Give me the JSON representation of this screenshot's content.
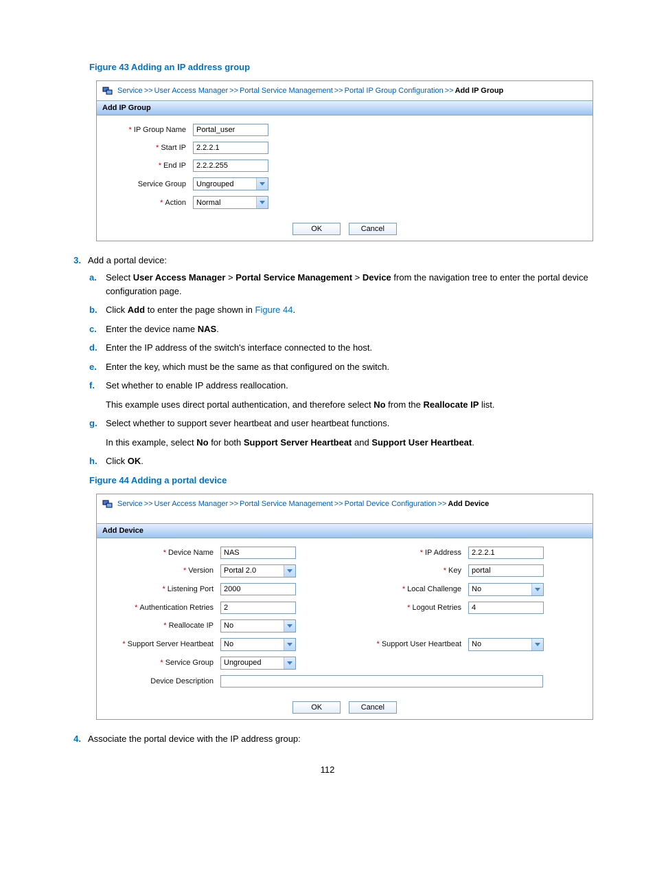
{
  "figure43": {
    "title": "Figure 43 Adding an IP address group",
    "breadcrumb": {
      "parts": [
        "Service",
        "User Access Manager",
        "Portal Service Management",
        "Portal IP Group Configuration"
      ],
      "current": "Add IP Group"
    },
    "panel_title": "Add IP Group",
    "rows": {
      "ip_group_name": {
        "label": "IP Group Name",
        "value": "Portal_user"
      },
      "start_ip": {
        "label": "Start IP",
        "value": "2.2.2.1"
      },
      "end_ip": {
        "label": "End IP",
        "value": "2.2.2.255"
      },
      "service_group": {
        "label": "Service Group",
        "value": "Ungrouped"
      },
      "action": {
        "label": "Action",
        "value": "Normal"
      }
    },
    "buttons": {
      "ok": "OK",
      "cancel": "Cancel"
    }
  },
  "step3": {
    "num": "3.",
    "text": "Add a portal device:",
    "subs": {
      "a": {
        "letter": "a.",
        "pre": "Select ",
        "b1": "User Access Manager",
        "gt1": " > ",
        "b2": "Portal Service Management",
        "gt2": " > ",
        "b3": "Device",
        "post": " from the navigation tree to enter the portal device configuration page."
      },
      "b": {
        "letter": "b.",
        "pre": "Click ",
        "b1": "Add",
        "mid": " to enter the page shown in ",
        "link": "Figure 44",
        "post": "."
      },
      "c": {
        "letter": "c.",
        "pre": "Enter the device name ",
        "b1": "NAS",
        "post": "."
      },
      "d": {
        "letter": "d.",
        "text": "Enter the IP address of the switch's interface connected to the host."
      },
      "e": {
        "letter": "e.",
        "text": "Enter the key, which must be the same as that configured on the switch."
      },
      "f": {
        "letter": "f.",
        "text": "Set whether to enable IP address reallocation.",
        "extra_pre": "This example uses direct portal authentication, and therefore select ",
        "extra_b1": "No",
        "extra_mid": " from the ",
        "extra_b2": "Reallocate IP",
        "extra_post": " list."
      },
      "g": {
        "letter": "g.",
        "text": "Select whether to support sever heartbeat and user heartbeat functions.",
        "extra_pre": "In this example, select ",
        "extra_b1": "No",
        "extra_mid1": " for both ",
        "extra_b2": "Support Server Heartbeat",
        "extra_mid2": " and ",
        "extra_b3": "Support User Heartbeat",
        "extra_post": "."
      },
      "h": {
        "letter": "h.",
        "pre": "Click ",
        "b1": "OK",
        "post": "."
      }
    }
  },
  "figure44": {
    "title": "Figure 44 Adding a portal device",
    "breadcrumb": {
      "parts": [
        "Service",
        "User Access Manager",
        "Portal Service Management",
        "Portal Device Configuration"
      ],
      "current": "Add Device"
    },
    "panel_title": "Add Device",
    "rows": {
      "device_name": {
        "label": "Device Name",
        "value": "NAS"
      },
      "ip_address": {
        "label": "IP Address",
        "value": "2.2.2.1"
      },
      "version": {
        "label": "Version",
        "value": "Portal 2.0"
      },
      "key": {
        "label": "Key",
        "value": "portal"
      },
      "listening_port": {
        "label": "Listening Port",
        "value": "2000"
      },
      "local_challenge": {
        "label": "Local Challenge",
        "value": "No"
      },
      "auth_retries": {
        "label": "Authentication Retries",
        "value": "2"
      },
      "logout_retries": {
        "label": "Logout Retries",
        "value": "4"
      },
      "reallocate_ip": {
        "label": "Reallocate IP",
        "value": "No"
      },
      "ssh": {
        "label": "Support Server Heartbeat",
        "value": "No"
      },
      "suh": {
        "label": "Support User Heartbeat",
        "value": "No"
      },
      "service_group": {
        "label": "Service Group",
        "value": "Ungrouped"
      },
      "device_desc": {
        "label": "Device Description",
        "value": ""
      }
    },
    "buttons": {
      "ok": "OK",
      "cancel": "Cancel"
    }
  },
  "step4": {
    "num": "4.",
    "text": "Associate the portal device with the IP address group:"
  },
  "page_number": "112"
}
